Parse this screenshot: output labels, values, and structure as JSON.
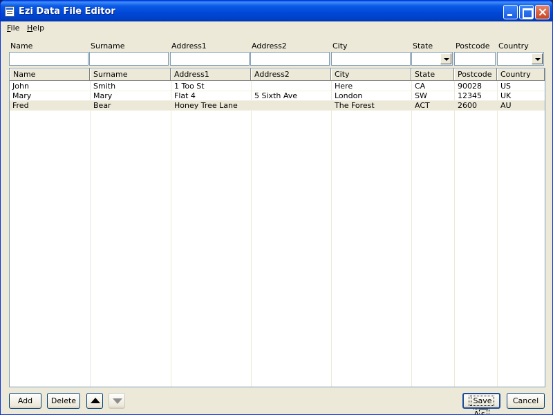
{
  "window": {
    "title": "Ezi Data File Editor"
  },
  "menu": {
    "file": {
      "underline": "F",
      "rest": "ile"
    },
    "help": {
      "underline": "H",
      "rest": "elp"
    }
  },
  "filters": {
    "name": {
      "label": "Name",
      "value": ""
    },
    "surname": {
      "label": "Surname",
      "value": ""
    },
    "address1": {
      "label": "Address1",
      "value": ""
    },
    "address2": {
      "label": "Address2",
      "value": ""
    },
    "city": {
      "label": "City",
      "value": ""
    },
    "state": {
      "label": "State",
      "value": ""
    },
    "postcode": {
      "label": "Postcode",
      "value": ""
    },
    "country": {
      "label": "Country",
      "value": ""
    }
  },
  "grid": {
    "columns": [
      "Name",
      "Surname",
      "Address1",
      "Address2",
      "City",
      "State",
      "Postcode",
      "Country"
    ],
    "rows": [
      [
        "John",
        "Smith",
        "1 Too St",
        "",
        "Here",
        "CA",
        "90028",
        "US"
      ],
      [
        "Mary",
        "Mary",
        "Flat 4",
        "5 Sixth Ave",
        "London",
        "SW",
        "12345",
        "UK"
      ],
      [
        "Fred",
        "Bear",
        "Honey Tree Lane",
        "",
        "The Forest",
        "ACT",
        "2600",
        "AU"
      ]
    ],
    "selected_row": 2
  },
  "buttons": {
    "add": "Add",
    "delete": "Delete",
    "move_up": "move-up-icon",
    "move_down": "move-down-icon",
    "save_as": {
      "before": "Save ",
      "underline": "A",
      "after": "s"
    },
    "cancel": "Cancel"
  }
}
